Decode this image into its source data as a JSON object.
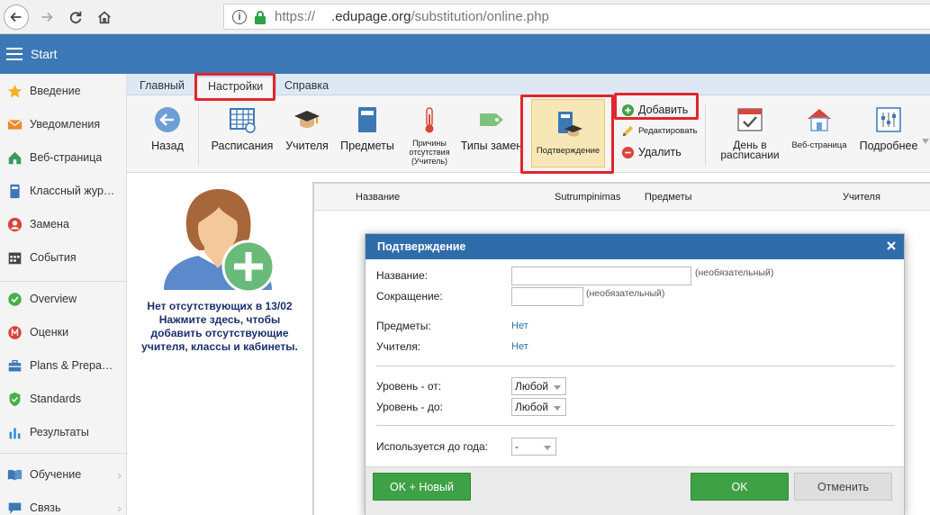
{
  "browser": {
    "url_scheme": "https://",
    "url_host": ".edupage.org",
    "url_path": "/substitution/online.php"
  },
  "app": {
    "title": "Start"
  },
  "sidebar": {
    "items": [
      {
        "label": "Введение",
        "icon": "star-icon",
        "color": "#f0b323"
      },
      {
        "label": "Уведомления",
        "icon": "envelope-icon",
        "color": "#e98b2a"
      },
      {
        "label": "Веб-страница",
        "icon": "house-icon",
        "color": "#3a9b62"
      },
      {
        "label": "Классный жур…",
        "icon": "book-icon",
        "color": "#3d78b6"
      },
      {
        "label": "Замена",
        "icon": "person-icon",
        "color": "#d9443b"
      },
      {
        "label": "События",
        "icon": "calendar-icon",
        "color": "#444444"
      },
      {
        "label": "Overview",
        "icon": "check-circle-icon",
        "color": "#43b04a"
      },
      {
        "label": "Оценки",
        "icon": "grade-icon",
        "color": "#d9443b"
      },
      {
        "label": "Plans & Prepa…",
        "icon": "briefcase-icon",
        "color": "#3d78b6"
      },
      {
        "label": "Standards",
        "icon": "shield-check-icon",
        "color": "#43b04a"
      },
      {
        "label": "Результаты",
        "icon": "bar-chart-icon",
        "color": "#2e8fd6"
      },
      {
        "label": "Обучение",
        "icon": "open-book-icon",
        "color": "#3d78b6"
      },
      {
        "label": "Связь",
        "icon": "chat-icon",
        "color": "#3d78b6"
      }
    ]
  },
  "ribbon": {
    "tabs": [
      {
        "label": "Главный"
      },
      {
        "label": "Настройки"
      },
      {
        "label": "Справка"
      }
    ],
    "buttons": {
      "back": "Назад",
      "schedules": "Расписания",
      "teachers": "Учителя",
      "subjects": "Предметы",
      "absence_reasons": "Причины отсутствия (Учитель)",
      "replacement_types": "Типы замен",
      "confirmation": "Подтверждение",
      "add": "Добавить",
      "edit": "Редактировать",
      "delete": "Удалить",
      "day_in_schedule": "День в расписании",
      "web_page": "Веб-страница",
      "more": "Подробнее"
    }
  },
  "left_panel": {
    "message_line1": "Нет отсутствующих в 13/02",
    "message_line2": "Нажмите здесь, чтобы добавить отсутствующие учителя, классы и кабинеты."
  },
  "table": {
    "columns": [
      "Название",
      "Sutrumpinimas",
      "Предметы",
      "Учителя"
    ]
  },
  "modal": {
    "title": "Подтверждение",
    "fields": {
      "name_label": "Название:",
      "name_hint": "(необязательный)",
      "abbr_label": "Сокращение:",
      "abbr_hint": "(необязательный)",
      "subjects_label": "Предметы:",
      "subjects_value": "Нет",
      "teachers_label": "Учителя:",
      "teachers_value": "Нет",
      "level_from_label": "Уровень - от:",
      "level_from_value": "Любой",
      "level_to_label": "Уровень - до:",
      "level_to_value": "Любой",
      "used_until_label": "Используется до года:",
      "used_until_value": "-"
    },
    "buttons": {
      "ok_new": "OK + Новый",
      "ok": "OK",
      "cancel": "Отменить"
    }
  }
}
